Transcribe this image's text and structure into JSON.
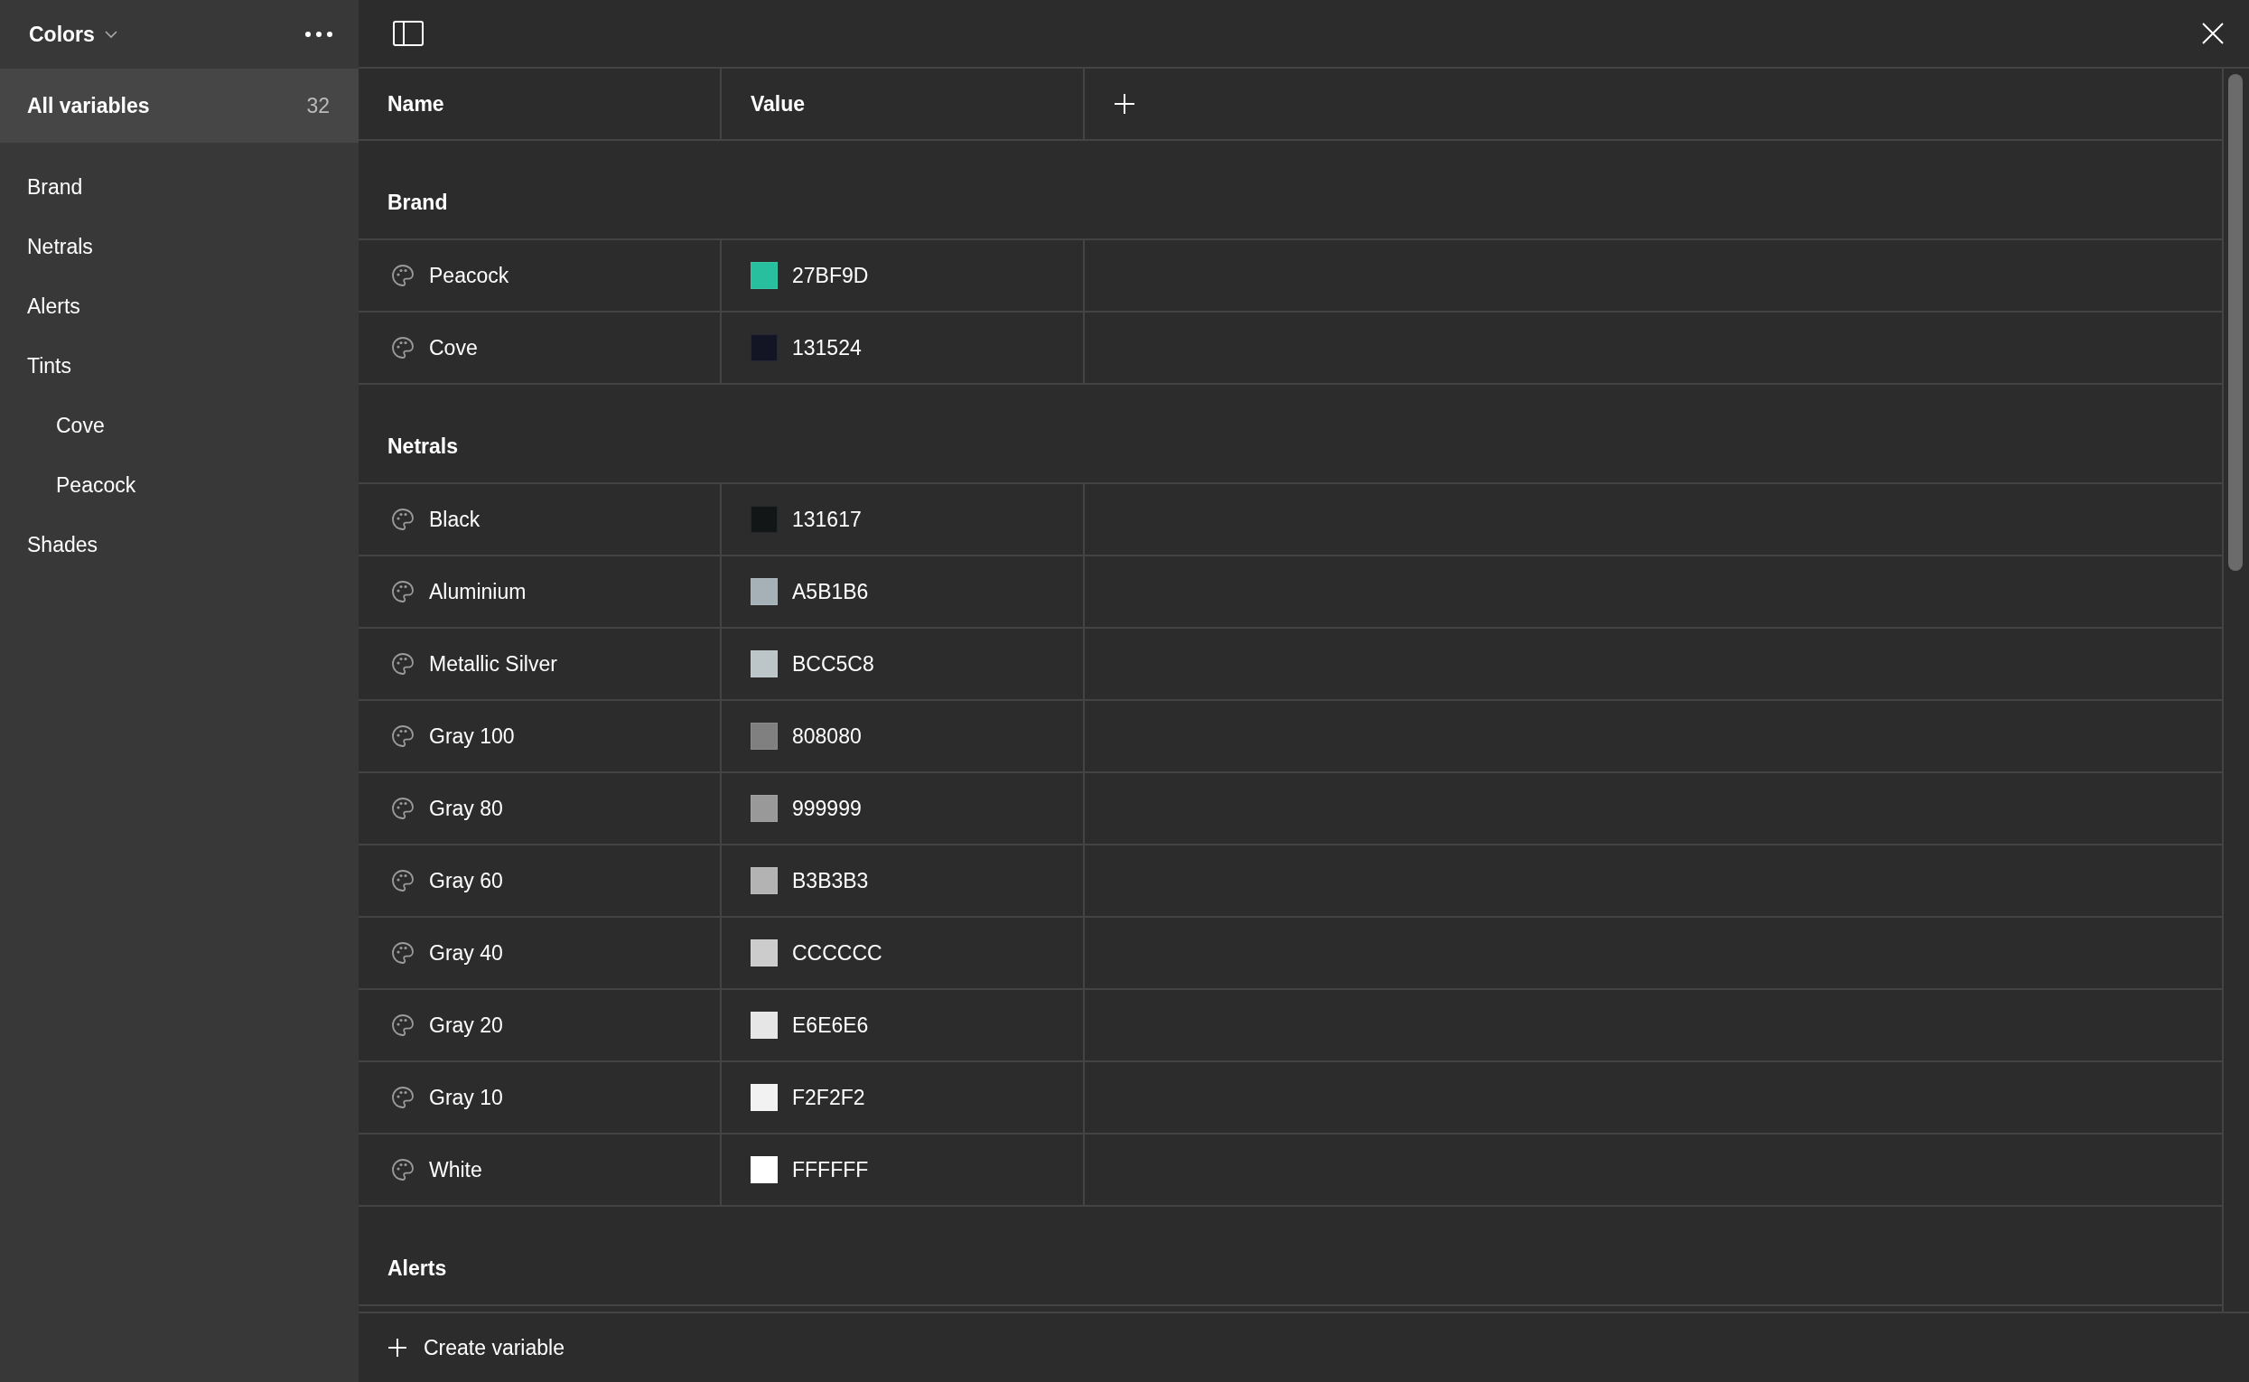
{
  "sidebar": {
    "collection": "Colors",
    "header_item": {
      "label": "All variables",
      "count": "32",
      "selected": true
    },
    "items": [
      {
        "label": "Brand",
        "selected": false
      },
      {
        "label": "Netrals",
        "selected": false
      },
      {
        "label": "Alerts",
        "selected": false
      },
      {
        "label": "Tints",
        "selected": false,
        "children": [
          {
            "label": "Cove",
            "selected": false
          },
          {
            "label": "Peacock",
            "selected": false
          }
        ]
      },
      {
        "label": "Shades",
        "selected": false
      }
    ]
  },
  "table": {
    "columns": [
      "Name",
      "Value"
    ],
    "groups": [
      {
        "title": "Brand",
        "rows": [
          {
            "name": "Peacock",
            "value": "27BF9D",
            "color": "#27bf9d"
          },
          {
            "name": "Cove",
            "value": "131524",
            "color": "#131524"
          }
        ]
      },
      {
        "title": "Netrals",
        "rows": [
          {
            "name": "Black",
            "value": "131617",
            "color": "#131617"
          },
          {
            "name": "Aluminium",
            "value": "A5B1B6",
            "color": "#a5b1b6"
          },
          {
            "name": "Metallic Silver",
            "value": "BCC5C8",
            "color": "#bcc5c8"
          },
          {
            "name": "Gray 100",
            "value": "808080",
            "color": "#808080"
          },
          {
            "name": "Gray 80",
            "value": "999999",
            "color": "#999999"
          },
          {
            "name": "Gray 60",
            "value": "B3B3B3",
            "color": "#b3b3b3"
          },
          {
            "name": "Gray 40",
            "value": "CCCCCC",
            "color": "#cccccc"
          },
          {
            "name": "Gray 20",
            "value": "E6E6E6",
            "color": "#e6e6e6"
          },
          {
            "name": "Gray 10",
            "value": "F2F2F2",
            "color": "#f2f2f2"
          },
          {
            "name": "White",
            "value": "FFFFFF",
            "color": "#ffffff"
          }
        ]
      },
      {
        "title": "Alerts"
      }
    ]
  },
  "footer": {
    "button": "Create variable"
  }
}
